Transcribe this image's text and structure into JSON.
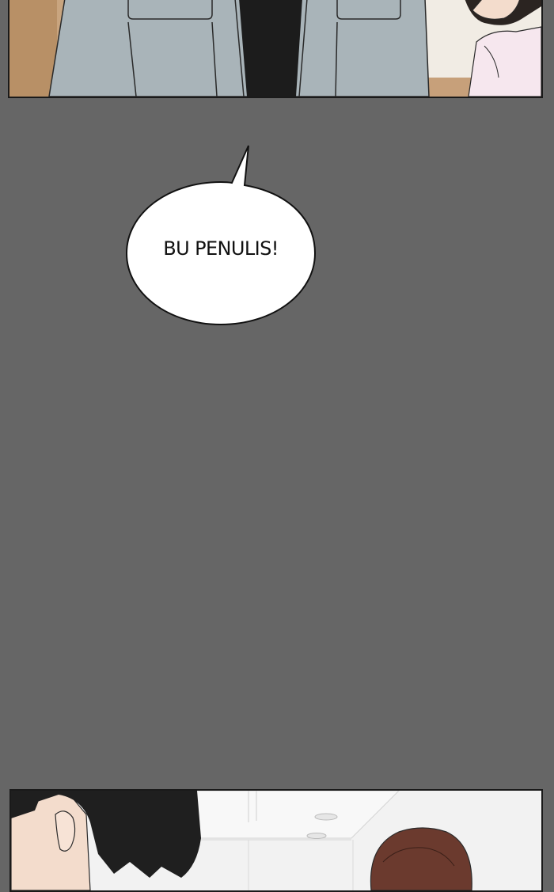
{
  "bubble": {
    "text": "BU PENULIS!"
  },
  "colors": {
    "gutter": "#666666",
    "bubble_fill": "#ffffff",
    "bubble_outline": "#111111",
    "jacket": "#a9b4b9",
    "shirt": "#1c1c1c",
    "hair_dark": "#1f1f1f",
    "hair_brown": "#6b3a2e",
    "skin": "#f3dccc",
    "wall": "#c9a57f",
    "blouse": "#f6e7ee"
  }
}
